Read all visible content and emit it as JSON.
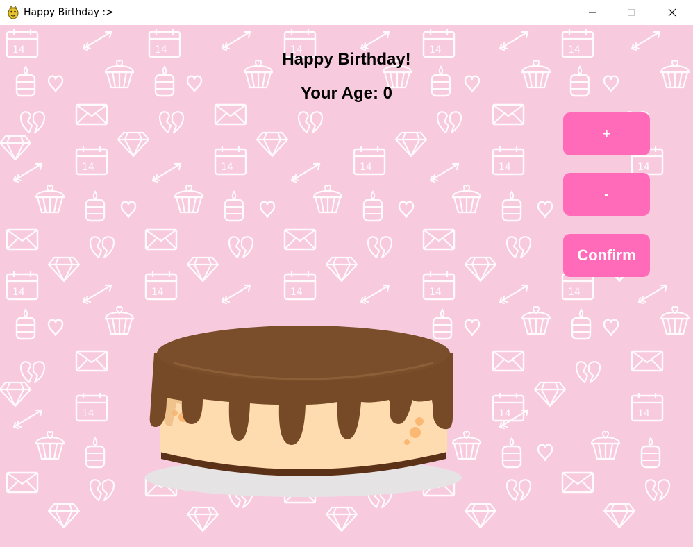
{
  "window": {
    "title": "Happy Birthday :>",
    "controls": {
      "minimize": "minimize-icon",
      "maximize": "maximize-icon",
      "close": "close-icon"
    }
  },
  "main": {
    "heading": "Happy Birthday!",
    "age_label": "Your Age: 0"
  },
  "controls": {
    "increment_label": "+",
    "decrement_label": "-",
    "confirm_label": "Confirm"
  },
  "colors": {
    "background": "#f8cade",
    "button": "#ff6ab9",
    "button_text": "#ffffff",
    "cake_chocolate": "#764a26",
    "cake_sponge": "#fedcb0"
  },
  "icons": [
    "python-app-icon",
    "minimize-icon",
    "maximize-icon",
    "close-icon",
    "cake-illustration",
    "background-pattern"
  ]
}
